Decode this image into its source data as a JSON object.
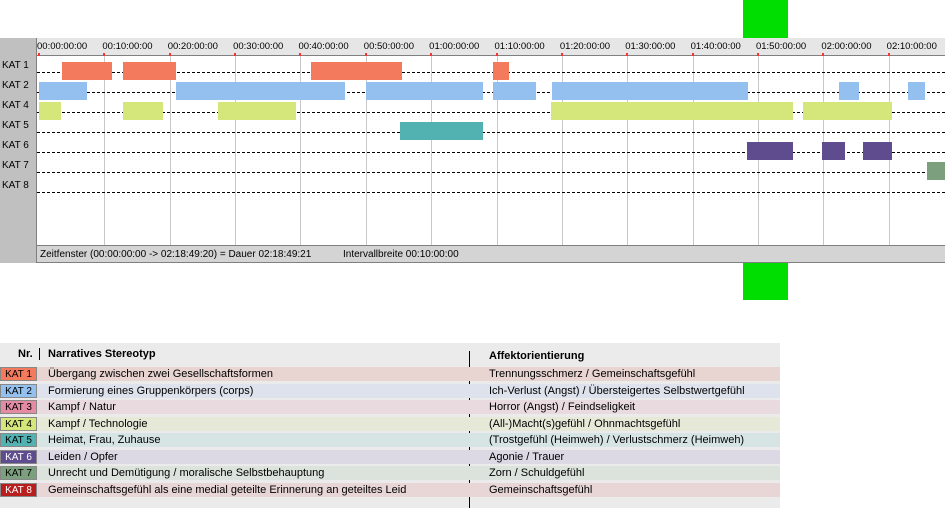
{
  "colors": {
    "green_marker": "#00dd00",
    "kat1": "#f47a5e",
    "kat2": "#93c0ee",
    "kat3": "#e48aa3",
    "kat4": "#d5e67b",
    "kat5": "#52b2b2",
    "kat6": "#5e4c8e",
    "kat7": "#7ca07e",
    "kat8": "#b81e1e"
  },
  "timeline": {
    "row_labels": [
      "KAT 1",
      "KAT 2",
      "KAT 4",
      "KAT 5",
      "KAT 6",
      "KAT 7",
      "KAT 8"
    ],
    "ticks": [
      "00:00:00:00",
      "00:10:00:00",
      "00:20:00:00",
      "00:30:00:00",
      "00:40:00:00",
      "00:50:00:00",
      "01:00:00:00",
      "01:10:00:00",
      "01:20:00:00",
      "01:30:00:00",
      "01:40:00:00",
      "01:50:00:00",
      "02:00:00:00",
      "02:10:00:00"
    ],
    "segments": [
      {
        "row": 0,
        "cat": "kat1",
        "start": 3.5,
        "end": 11.2
      },
      {
        "row": 0,
        "cat": "kat1",
        "start": 12.8,
        "end": 21.0
      },
      {
        "row": 0,
        "cat": "kat1",
        "start": 41.6,
        "end": 55.5
      },
      {
        "row": 0,
        "cat": "kat1",
        "start": 69.4,
        "end": 71.9
      },
      {
        "row": 1,
        "cat": "kat2",
        "start": 0,
        "end": 7.4
      },
      {
        "row": 1,
        "cat": "kat2",
        "start": 20.9,
        "end": 46.8
      },
      {
        "row": 1,
        "cat": "kat2",
        "start": 50.0,
        "end": 68.0
      },
      {
        "row": 1,
        "cat": "kat2",
        "start": 69.4,
        "end": 76.1
      },
      {
        "row": 1,
        "cat": "kat2",
        "start": 78.5,
        "end": 108.5
      },
      {
        "row": 1,
        "cat": "kat2",
        "start": 122.4,
        "end": 125.5
      },
      {
        "row": 1,
        "cat": "kat2",
        "start": 132.9,
        "end": 135.5
      },
      {
        "row": 2,
        "cat": "kat4",
        "start": 0,
        "end": 3.4
      },
      {
        "row": 2,
        "cat": "kat4",
        "start": 12.9,
        "end": 19.0
      },
      {
        "row": 2,
        "cat": "kat4",
        "start": 27.4,
        "end": 39.3
      },
      {
        "row": 2,
        "cat": "kat4",
        "start": 78.4,
        "end": 115.4
      },
      {
        "row": 2,
        "cat": "kat4",
        "start": 116.9,
        "end": 130.5
      },
      {
        "row": 3,
        "cat": "kat5",
        "start": 55.3,
        "end": 68.0
      },
      {
        "row": 4,
        "cat": "kat6",
        "start": 108.3,
        "end": 115.4
      },
      {
        "row": 4,
        "cat": "kat6",
        "start": 119.8,
        "end": 123.3
      },
      {
        "row": 4,
        "cat": "kat6",
        "start": 126.0,
        "end": 130.5
      },
      {
        "row": 5,
        "cat": "kat7",
        "start": 135.8,
        "end": 139.0
      }
    ],
    "status_text": "Zeitfenster (00:00:00:00 -> 02:18:49:20) = Dauer 02:18:49:21",
    "interval_text": "Intervallbreite 00:10:00:00"
  },
  "legend": {
    "col_nr": "Nr.",
    "col_stereotype": "Narratives Stereotyp",
    "col_affect": "Affektorientierung",
    "rows": [
      {
        "kat": "KAT 1",
        "color_key": "kat1",
        "row_bg": "#e8d5d2",
        "stereotype": "Übergang zwischen zwei Gesellschaftsformen",
        "affect": "Trennungsschmerz / Gemeinschaftsgefühl"
      },
      {
        "kat": "KAT 2",
        "color_key": "kat2",
        "row_bg": "#dde2ec",
        "stereotype": "Formierung eines Gruppenkörpers (corps)",
        "affect": "Ich-Verlust (Angst) / Übersteigertes Selbstwertgefühl"
      },
      {
        "kat": "KAT 3",
        "color_key": "kat3",
        "row_bg": "#e8dadf",
        "stereotype": "Kampf / Natur",
        "affect": "Horror (Angst) / Feindseligkeit"
      },
      {
        "kat": "KAT 4",
        "color_key": "kat4",
        "row_bg": "#e6e8d8",
        "stereotype": "Kampf / Technologie",
        "affect": "(All-)Macht(s)gefühl / Ohnmachtsgefühl"
      },
      {
        "kat": "KAT 5",
        "color_key": "kat5",
        "row_bg": "#d6e4e4",
        "stereotype": "Heimat, Frau, Zuhause",
        "affect": "(Trostgefühl (Heimweh) / Verlustschmerz (Heimweh)"
      },
      {
        "kat": "KAT 6",
        "color_key": "kat6",
        "row_bg": "#dcd9e4",
        "stereotype": "Leiden / Opfer",
        "affect": "Agonie / Trauer"
      },
      {
        "kat": "KAT 7",
        "color_key": "kat7",
        "row_bg": "#dce2dc",
        "stereotype": "Unrecht und Demütigung / moralische Selbstbehauptung",
        "affect": "Zorn / Schuldgefühl"
      },
      {
        "kat": "KAT 8",
        "color_key": "kat8",
        "row_bg": "#e8d6d6",
        "stereotype": "Gemeinschaftsgefühl als eine medial geteilte Erinnerung an geteiltes Leid",
        "affect": "Gemeinschaftsgefühl"
      }
    ]
  }
}
